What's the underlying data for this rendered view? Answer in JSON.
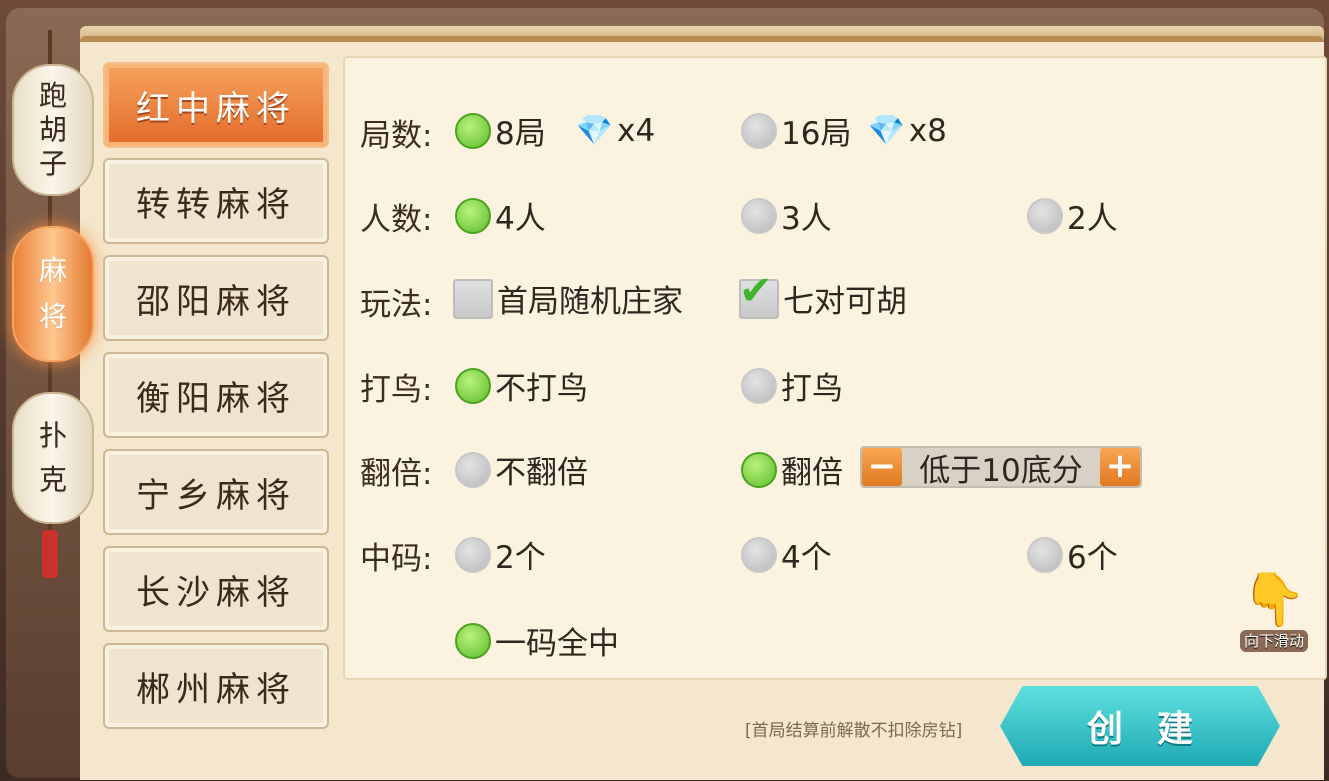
{
  "side_tabs": [
    {
      "label": [
        "跑",
        "胡",
        "子"
      ],
      "active": false
    },
    {
      "label": [
        "麻",
        "将"
      ],
      "active": true
    },
    {
      "label": [
        "扑",
        "克"
      ],
      "active": false
    }
  ],
  "game_types": [
    {
      "label": "红中麻将",
      "active": true
    },
    {
      "label": "转转麻将",
      "active": false
    },
    {
      "label": "邵阳麻将",
      "active": false
    },
    {
      "label": "衡阳麻将",
      "active": false
    },
    {
      "label": "宁乡麻将",
      "active": false
    },
    {
      "label": "长沙麻将",
      "active": false
    },
    {
      "label": "郴州麻将",
      "active": false
    }
  ],
  "rounds": {
    "label": "局数:",
    "options": [
      {
        "text": "8局",
        "cost": "x4",
        "selected": true
      },
      {
        "text": "16局",
        "cost": "x8",
        "selected": false
      }
    ]
  },
  "players": {
    "label": "人数:",
    "options": [
      {
        "text": "4人",
        "selected": true
      },
      {
        "text": "3人",
        "selected": false
      },
      {
        "text": "2人",
        "selected": false
      }
    ]
  },
  "play_style": {
    "label": "玩法:",
    "options": [
      {
        "text": "首局随机庄家",
        "checked": false
      },
      {
        "text": "七对可胡",
        "checked": true
      }
    ]
  },
  "bird": {
    "label": "打鸟:",
    "options": [
      {
        "text": "不打鸟",
        "selected": true
      },
      {
        "text": "打鸟",
        "selected": false
      }
    ]
  },
  "double": {
    "label": "翻倍:",
    "options": [
      {
        "text": "不翻倍",
        "selected": false
      },
      {
        "text": "翻倍",
        "selected": true
      }
    ],
    "stepper_value": "低于10底分",
    "minus": "−",
    "plus": "+"
  },
  "middle_code": {
    "label": "中码:",
    "options": [
      {
        "text": "2个",
        "selected": false
      },
      {
        "text": "4个",
        "selected": false
      },
      {
        "text": "6个",
        "selected": false
      },
      {
        "text": "一码全中",
        "selected": true
      }
    ]
  },
  "footnote": "[首局结算前解散不扣除房钻]",
  "create_button": "创建",
  "scroll_hint": "向下滑动",
  "colors": {
    "accent_orange": "#e26a2a",
    "radio_on": "#5dbd2b",
    "create_teal": "#1fa9b4"
  }
}
